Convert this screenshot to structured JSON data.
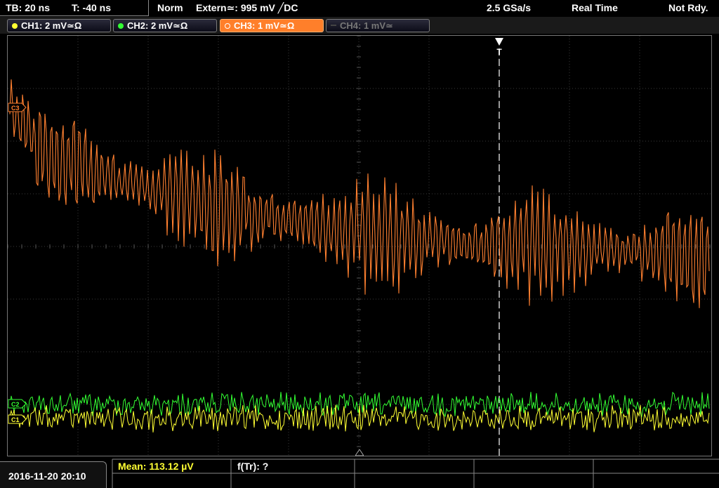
{
  "header": {
    "timebase": "TB: 20 ns",
    "trigger_offset": "T: -40 ns",
    "trigger_mode": "Norm",
    "trigger_source": "Extern≃: 995 mV ╱DC",
    "sample_rate": "2.5 GSa/s",
    "acq_mode": "Real Time",
    "status": "Not Rdy."
  },
  "channels": [
    {
      "label": "CH1: 2 mV≃Ω",
      "color": "#ffff33",
      "state": "on"
    },
    {
      "label": "CH2: 2 mV≃Ω",
      "color": "#33ff33",
      "state": "on"
    },
    {
      "label": "CH3: 1 mV≃Ω",
      "color": "#ff7f2a",
      "state": "active"
    },
    {
      "label": "CH4: 1 mV≃",
      "color": "#555555",
      "state": "off"
    }
  ],
  "footer": {
    "datetime": "2016-11-20 20:10",
    "measurement1": "Mean: 113.12 µV",
    "measurement2": "f(Tr): ?"
  },
  "markers": {
    "ch3": "C3",
    "ch2": "C2",
    "ch1": "C1",
    "trigger": "T"
  },
  "colors": {
    "ch1": "#ffff33",
    "ch2": "#33ff33",
    "ch3": "#ff8030",
    "grid": "#3a3a3a",
    "trigger_line": "#ffffff"
  }
}
